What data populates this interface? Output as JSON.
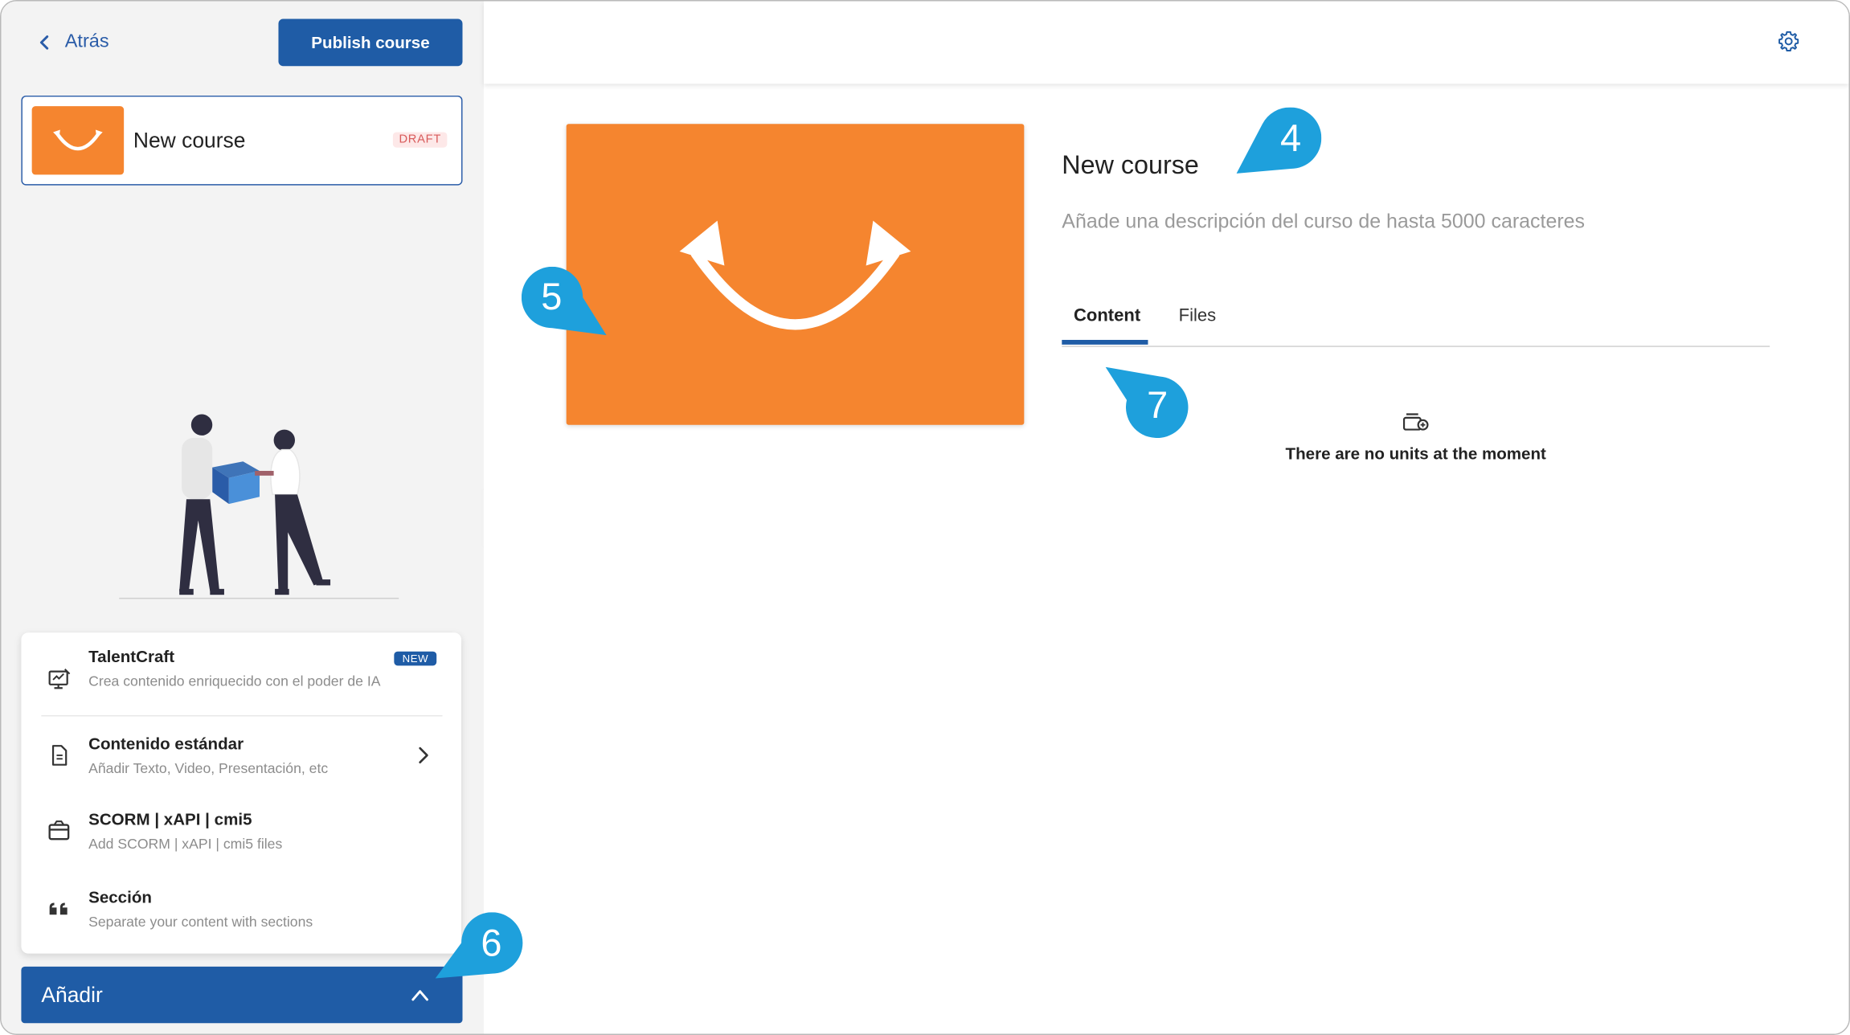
{
  "sidebar": {
    "back_label": "Atrás",
    "publish_label": "Publish course",
    "course": {
      "name": "New course",
      "status": "DRAFT"
    },
    "menu": [
      {
        "title": "TalentCraft",
        "desc": "Crea contenido enriquecido con el poder de IA",
        "badge": "NEW",
        "icon": "ai-monitor-icon"
      },
      {
        "title": "Contenido estándar",
        "desc": "Añadir Texto, Video, Presentación, etc",
        "icon": "document-icon"
      },
      {
        "title": "SCORM | xAPI | cmi5",
        "desc": "Add SCORM | xAPI | cmi5 files",
        "icon": "package-icon"
      },
      {
        "title": "Sección",
        "desc": "Separate your content with sections",
        "icon": "quote-icon"
      }
    ],
    "add_label": "Añadir"
  },
  "main": {
    "title": "New course",
    "description_placeholder": "Añade una descripción del curso de hasta 5000 caracteres",
    "tabs": [
      {
        "label": "Content",
        "active": true
      },
      {
        "label": "Files",
        "active": false
      }
    ],
    "empty_text": "There are no units at the moment"
  },
  "callouts": [
    "4",
    "5",
    "6",
    "7"
  ],
  "colors": {
    "primary": "#1f5ca6",
    "orange": "#f5852f",
    "callout": "#1ea0dc"
  }
}
